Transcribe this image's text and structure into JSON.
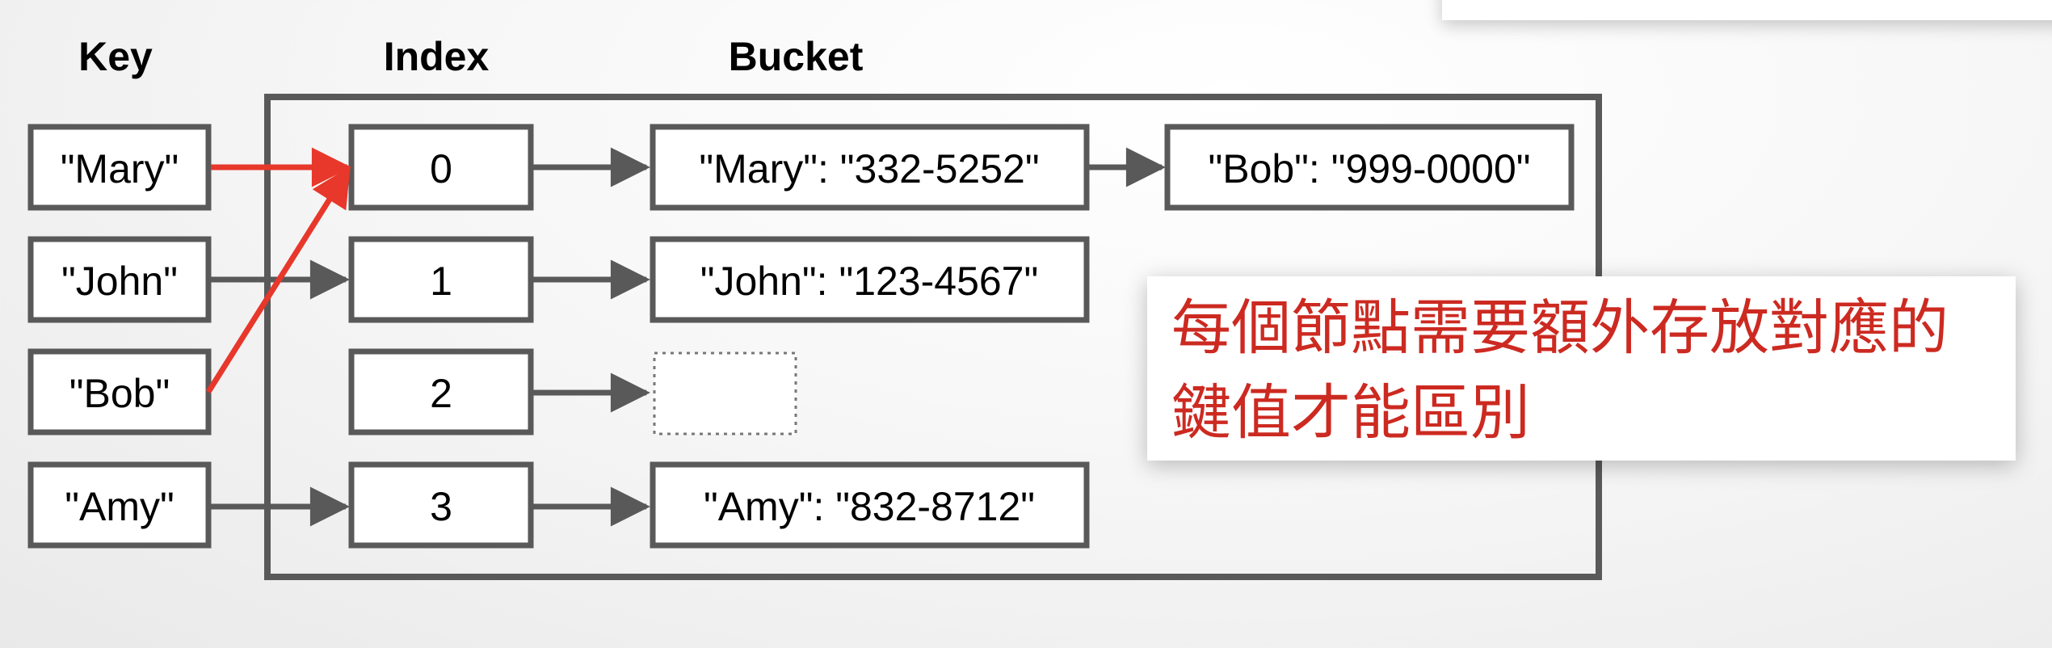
{
  "headers": {
    "key": "Key",
    "index": "Index",
    "bucket": "Bucket"
  },
  "keys": [
    "\"Mary\"",
    "\"John\"",
    "\"Bob\"",
    "\"Amy\""
  ],
  "indices": [
    "0",
    "1",
    "2",
    "3"
  ],
  "buckets": {
    "row0_first": "\"Mary\": \"332-5252\"",
    "row0_second": "\"Bob\": \"999-0000\"",
    "row1": "\"John\": \"123-4567\"",
    "row3": "\"Amy\": \"832-8712\""
  },
  "note": "每個節點需要額外存放對應的鍵值才能區別",
  "colors": {
    "outline": "#595959",
    "highlight": "#e8372b",
    "note_text": "#cc2a21"
  }
}
